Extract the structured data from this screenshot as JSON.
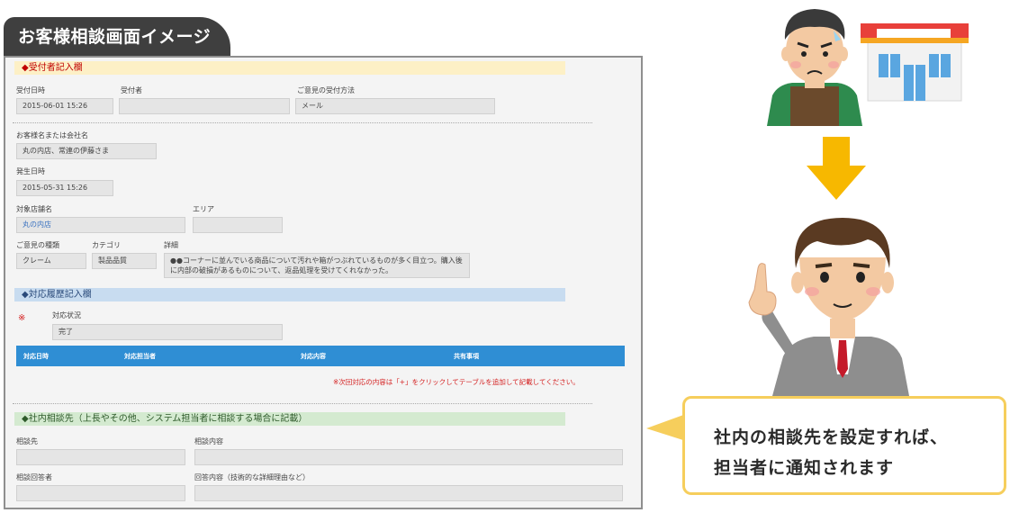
{
  "title": "お客様相談画面イメージ",
  "reception": {
    "heading": "◆受付者記入欄",
    "date_label": "受付日時",
    "date_value": "2015-06-01 15:26",
    "receiver_label": "受付者",
    "receiver_value": "",
    "method_label": "ご意見の受付方法",
    "method_value": "メール"
  },
  "customer": {
    "name_label": "お客様名または会社名",
    "name_value": "丸の内店、常連の伊藤さま",
    "occurred_label": "発生日時",
    "occurred_value": "2015-05-31 15:26",
    "store_label": "対象店舗名",
    "store_value": "丸の内店",
    "area_label": "エリア",
    "area_value": "",
    "type_label": "ご意見の種類",
    "type_value": "クレーム",
    "category_label": "カテゴリ",
    "category_value": "製品品質",
    "detail_label": "詳細",
    "detail_value": "●●コーナーに並んでいる商品について汚れや箱がつぶれているものが多く目立つ。購入後に内部の破損があるものについて、返品処理を受けてくれなかった。"
  },
  "history": {
    "heading": "◆対応履歴記入欄",
    "required_mark": "※",
    "status_label": "対応状況",
    "status_value": "完了",
    "columns": [
      "対応日時",
      "対応担当者",
      "対応内容",
      "共有事項"
    ],
    "note": "※次回対応の内容は「+」をクリックしてテーブルを追加して記載してください。"
  },
  "internal": {
    "heading": "◆社内相談先（上長やその他、システム担当者に相談する場合に記載）",
    "consult_label": "相談先",
    "consult_value": "",
    "content_label": "相談内容",
    "content_value": "",
    "answerer_label": "相談回答者",
    "answerer_value": "",
    "answer_label": "回答内容（技術的な詳細理由など）",
    "answer_value": ""
  },
  "callout": {
    "line1": "社内の相談先を設定すれば、",
    "line2": "担当者に通知されます"
  },
  "colors": {
    "accent_blue": "#2f8ed4",
    "arrow_yellow": "#f7b800",
    "callout_border": "#f6ce5c"
  },
  "icons": [
    "worried-customer-icon",
    "store-icon",
    "down-arrow-icon",
    "businessman-pointing-icon"
  ]
}
